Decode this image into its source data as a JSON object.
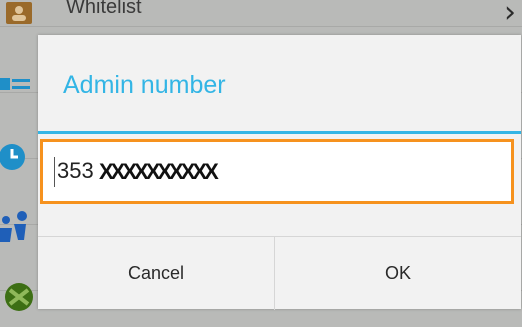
{
  "background": {
    "list_title": "Whitelist",
    "rows": [
      {
        "icon": "contact-card-icon",
        "color": "#c77a1e"
      },
      {
        "icon": "list-icon",
        "color": "#2a9fd6"
      },
      {
        "icon": "clock-icon",
        "color": "#2a9fd6"
      },
      {
        "icon": "people-icon",
        "color": "#2a6fd6"
      },
      {
        "icon": "android-icon",
        "color": "#4a7f1a"
      }
    ]
  },
  "dialog": {
    "title": "Admin number",
    "input_prefix": "353",
    "input_masked": "XXXXXXXXXX",
    "cancel_label": "Cancel",
    "ok_label": "OK"
  },
  "colors": {
    "accent": "#33b5e5",
    "focus_border": "#f6921e"
  }
}
